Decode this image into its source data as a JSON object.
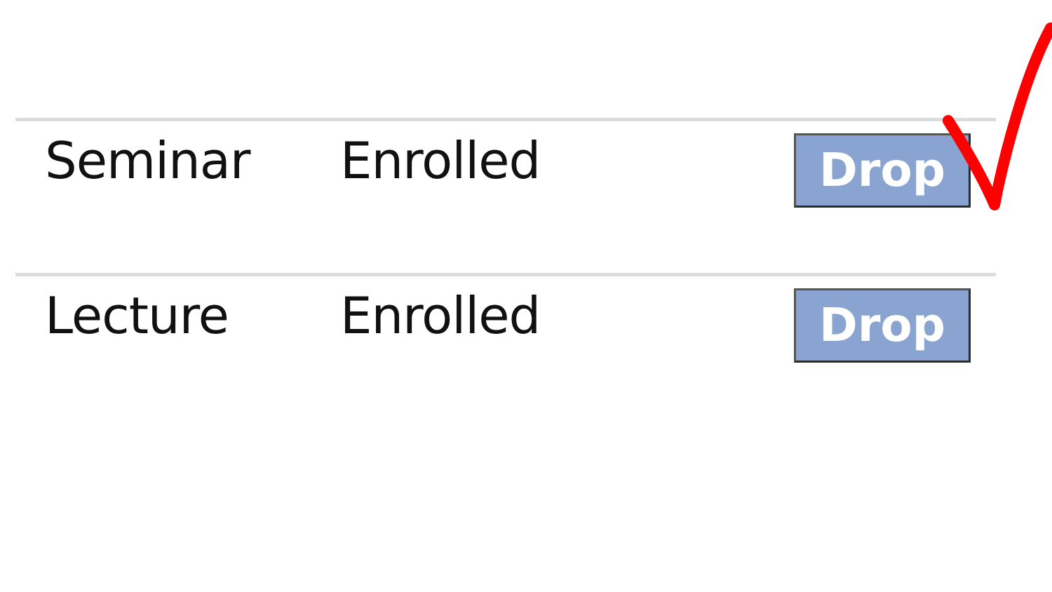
{
  "enrollments": [
    {
      "type": "Seminar",
      "status": "Enrolled",
      "action_label": "Drop"
    },
    {
      "type": "Lecture",
      "status": "Enrolled",
      "action_label": "Drop"
    }
  ],
  "colors": {
    "button_fill": "#8aa4d2",
    "divider": "#dcdcdc",
    "check_mark": "#ff0000"
  },
  "annotation": {
    "icon": "checkmark-icon"
  }
}
